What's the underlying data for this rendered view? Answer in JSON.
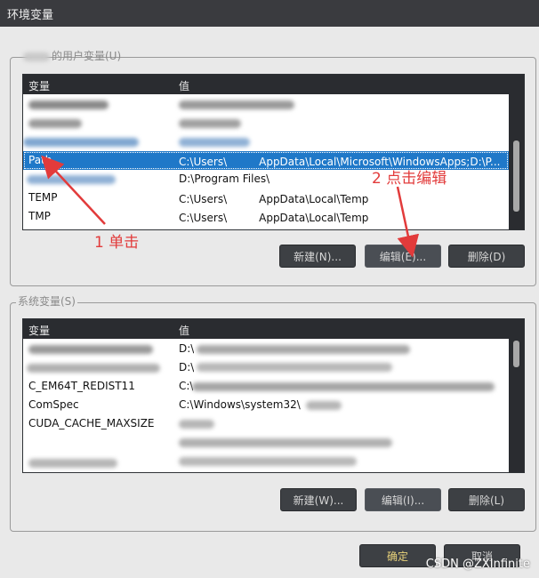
{
  "window": {
    "title": "环境变量"
  },
  "user_vars": {
    "group_label": "的用户变量(U)",
    "col_name": "变量",
    "col_value": "值",
    "rows": [
      {
        "name": "",
        "value": ""
      },
      {
        "name": "",
        "value": ""
      },
      {
        "name": "",
        "value": ""
      },
      {
        "name": "Path",
        "value": "C:\\Users\\　　　AppData\\Local\\Microsoft\\WindowsApps;D:\\P..."
      },
      {
        "name": "",
        "value": "D:\\Program Files\\"
      },
      {
        "name": "TEMP",
        "value": "C:\\Users\\　　　AppData\\Local\\Temp"
      },
      {
        "name": "TMP",
        "value": "C:\\Users\\　　　AppData\\Local\\Temp"
      }
    ],
    "selected_index": 3,
    "buttons": {
      "new": "新建(N)...",
      "edit": "编辑(E)...",
      "delete": "删除(D)"
    }
  },
  "system_vars": {
    "group_label": "系统变量(S)",
    "col_name": "变量",
    "col_value": "值",
    "rows": [
      {
        "name": "",
        "value": "D:\\"
      },
      {
        "name": "",
        "value": "D:\\"
      },
      {
        "name": "C_EM64T_REDIST11",
        "value": "C:\\"
      },
      {
        "name": "ComSpec",
        "value": "C:\\Windows\\system32\\"
      },
      {
        "name": "CUDA_CACHE_MAXSIZE",
        "value": ""
      },
      {
        "name": "",
        "value": ""
      },
      {
        "name": "",
        "value": ""
      }
    ],
    "buttons": {
      "new": "新建(W)...",
      "edit": "编辑(I)...",
      "delete": "删除(L)"
    }
  },
  "dialog_buttons": {
    "ok": "确定",
    "cancel": "取消"
  },
  "annotations": {
    "step1": "1 单击",
    "step2": "2 点击编辑"
  },
  "watermark": "CSDN @ZXInfinite",
  "colors": {
    "selection": "#1f78c8",
    "annotation": "#e23b3b",
    "header": "#2a2c30"
  }
}
